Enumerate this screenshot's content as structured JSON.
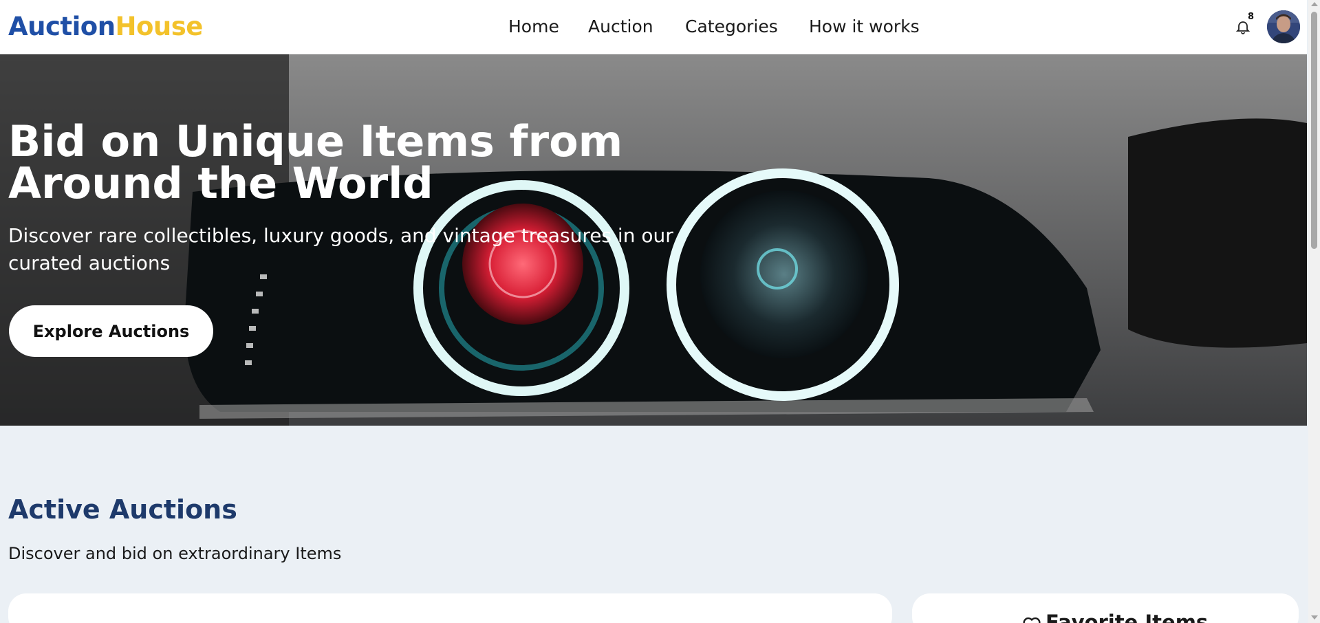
{
  "header": {
    "logo_part1": "Auction",
    "logo_part2": "House",
    "nav": [
      "Home",
      "Auction",
      "Categories",
      "How it works"
    ],
    "notification_count": "8",
    "notification_icon": "bell-icon",
    "avatar_icon": "user-avatar"
  },
  "hero": {
    "title": "Bid on Unique Items from Around the World",
    "subtitle": "Discover rare collectibles, luxury goods, and vintage treasures in our curated auctions",
    "cta_label": "Explore Auctions",
    "background_image": "car-headlight-photo"
  },
  "section": {
    "title": "Active Auctions",
    "subtitle": "Discover and bid on extraordinary Items"
  },
  "favorites": {
    "title": "Favorite Items",
    "icon": "heart-icon"
  },
  "colors": {
    "logo_blue": "#1f4fa6",
    "logo_yellow": "#f3c22b",
    "section_title": "#1e3a6b",
    "page_bg": "#ebf0f5"
  }
}
